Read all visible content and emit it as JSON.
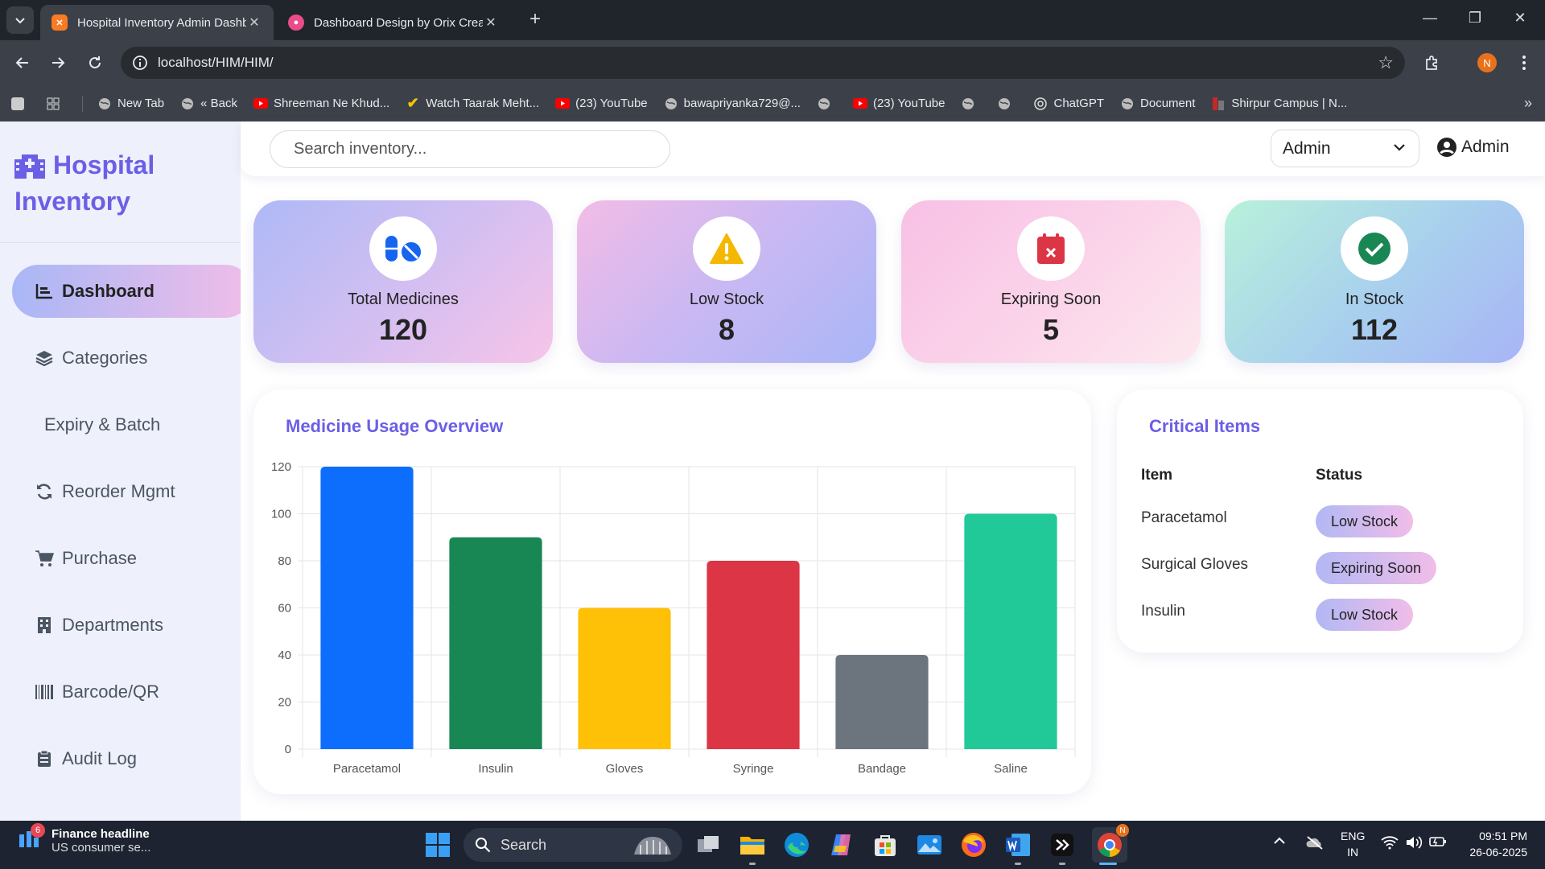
{
  "browser": {
    "tabs": [
      {
        "title": "Hospital Inventory Admin Dashboard",
        "active": true
      },
      {
        "title": "Dashboard Design by Orix Creative",
        "active": false
      }
    ],
    "url": "localhost/HIM/HIM/",
    "profile_initial": "N",
    "bookmarks": [
      "New Tab",
      "« Back",
      "Shreeman Ne Khud...",
      "Watch Taarak Meht...",
      "(23) YouTube",
      "bawapriyanka729@...",
      "(23) YouTube",
      "ChatGPT",
      "Document",
      "Shirpur Campus | N..."
    ]
  },
  "sidebar": {
    "brand_line1": "Hospital",
    "brand_line2": "Inventory",
    "items": [
      {
        "label": "Dashboard",
        "icon": "chart-line-icon",
        "active": true
      },
      {
        "label": "Categories",
        "icon": "layers-icon"
      },
      {
        "label": "Expiry & Batch",
        "icon": ""
      },
      {
        "label": "Reorder Mgmt",
        "icon": "sync-icon"
      },
      {
        "label": "Purchase",
        "icon": "cart-icon"
      },
      {
        "label": "Departments",
        "icon": "building-icon"
      },
      {
        "label": "Barcode/QR",
        "icon": "barcode-icon"
      },
      {
        "label": "Audit Log",
        "icon": "clipboard-icon"
      }
    ]
  },
  "topbar": {
    "search_placeholder": "Search inventory...",
    "role_value": "Admin",
    "user_name": "Admin"
  },
  "stats": [
    {
      "label": "Total Medicines",
      "value": "120",
      "icon": "pills-icon",
      "icon_color": "#1565f0"
    },
    {
      "label": "Low Stock",
      "value": "8",
      "icon": "warning-icon",
      "icon_color": "#f5b800"
    },
    {
      "label": "Expiring Soon",
      "value": "5",
      "icon": "calendar-x-icon",
      "icon_color": "#dc3545"
    },
    {
      "label": "In Stock",
      "value": "112",
      "icon": "check-circle-icon",
      "icon_color": "#198754"
    }
  ],
  "usage_panel": {
    "title": "Medicine Usage Overview"
  },
  "chart_data": {
    "type": "bar",
    "title": "",
    "xlabel": "",
    "ylabel": "",
    "categories": [
      "Paracetamol",
      "Insulin",
      "Gloves",
      "Syringe",
      "Bandage",
      "Saline"
    ],
    "values": [
      120,
      90,
      60,
      80,
      40,
      100
    ],
    "colors": [
      "#0d6efd",
      "#198754",
      "#ffc107",
      "#dc3545",
      "#6c757d",
      "#20c997"
    ],
    "ylim": [
      0,
      120
    ],
    "yticks": [
      0,
      20,
      40,
      60,
      80,
      100,
      120
    ],
    "grid": true,
    "legend": "none"
  },
  "critical": {
    "title": "Critical Items",
    "col_item": "Item",
    "col_status": "Status",
    "rows": [
      {
        "item": "Paracetamol",
        "status": "Low Stock"
      },
      {
        "item": "Surgical Gloves",
        "status": "Expiring Soon"
      },
      {
        "item": "Insulin",
        "status": "Low Stock"
      }
    ]
  },
  "taskbar": {
    "news_title": "Finance headline",
    "news_sub": "US consumer se...",
    "news_badge": "6",
    "search_label": "Search",
    "lang_line1": "ENG",
    "lang_line2": "IN",
    "time": "09:51 PM",
    "date": "26-06-2025"
  }
}
